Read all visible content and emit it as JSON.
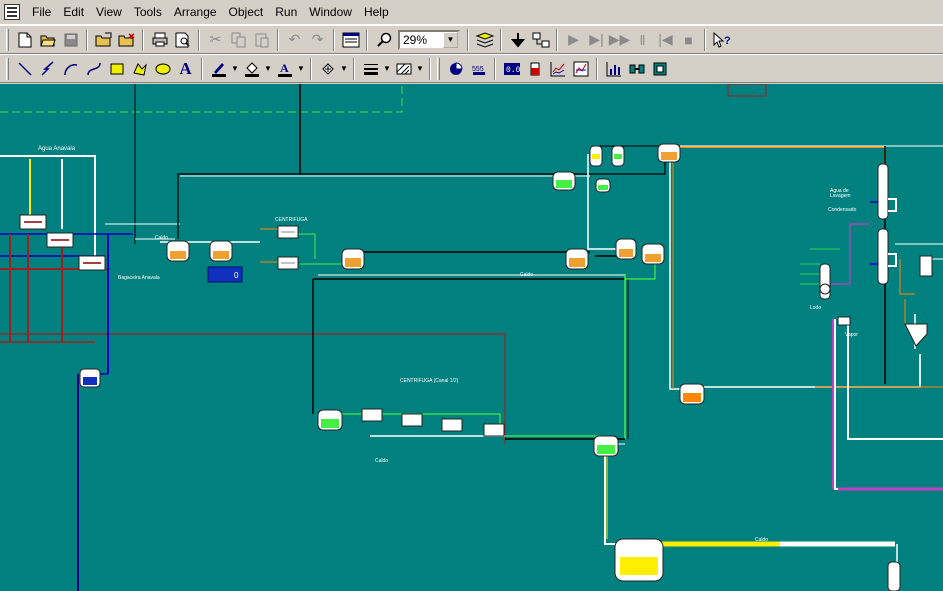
{
  "menubar": {
    "items": [
      "File",
      "Edit",
      "View",
      "Tools",
      "Arrange",
      "Object",
      "Run",
      "Window",
      "Help"
    ]
  },
  "toolbar": {
    "zoom_value": "29%"
  },
  "canvas": {
    "background": "#00807f",
    "label_agua": "Agua Anavala",
    "label_stage2": "CENTRIFUGA (Canal 1/2)",
    "display_box_value": "0",
    "tanks": {
      "orange": "#f0a030",
      "green": "#44ee44",
      "yellow": "#ffee00",
      "blue": "#1030c0",
      "bright_orange": "#ff8800"
    }
  }
}
